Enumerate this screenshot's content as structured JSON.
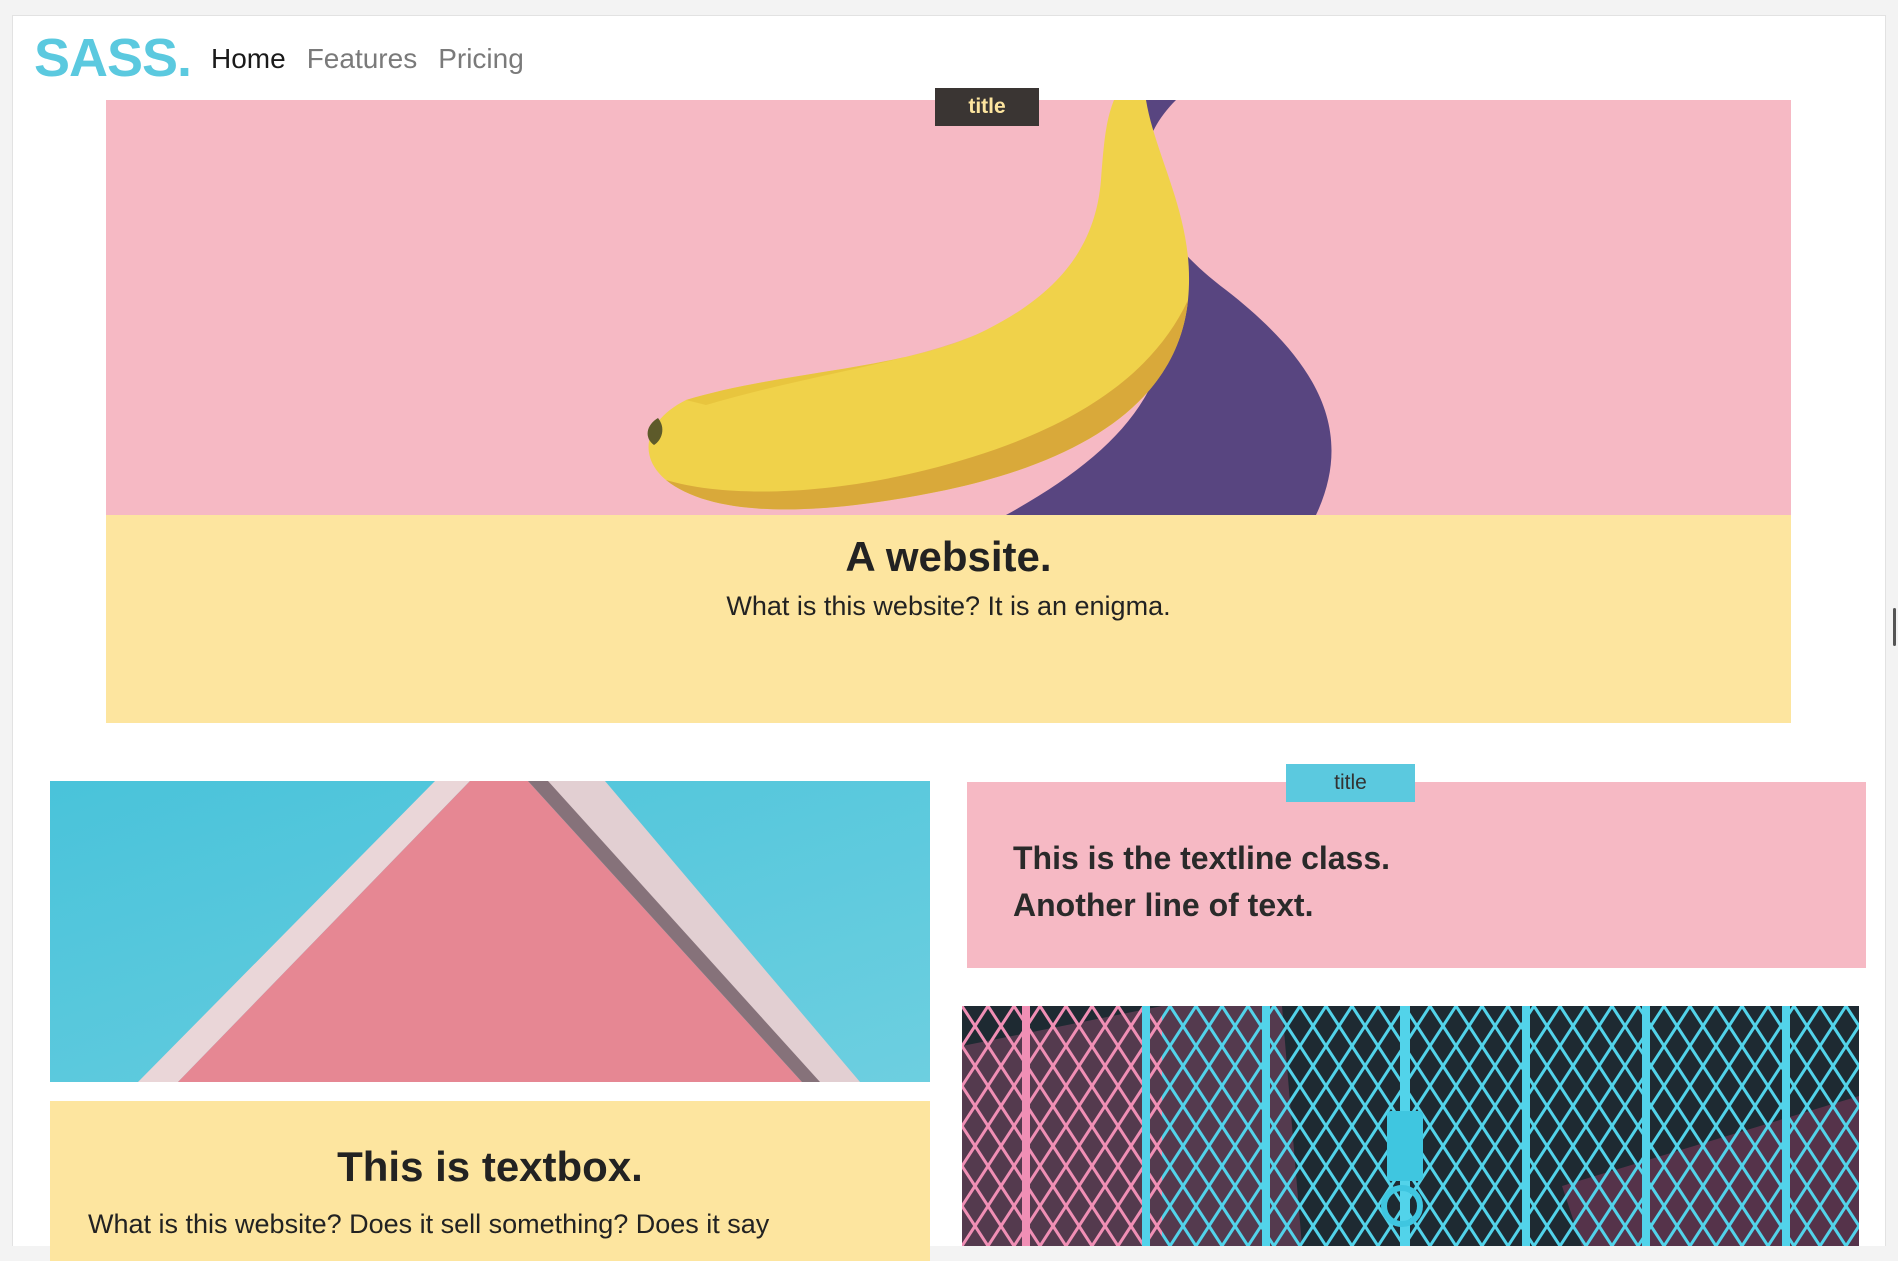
{
  "brand": {
    "logo": "SASS."
  },
  "nav": {
    "items": [
      {
        "label": "Home",
        "active": true
      },
      {
        "label": "Features",
        "active": false
      },
      {
        "label": "Pricing",
        "active": false
      }
    ]
  },
  "hero": {
    "tag": "title",
    "heading": "A website.",
    "subheading": "What is this website? It is an enigma."
  },
  "textbox": {
    "heading": "This is textbox.",
    "body": "What is this website? Does it sell something? Does it say"
  },
  "textline": {
    "tag": "title",
    "line1": "This is the textline class.",
    "line2": "Another line of text."
  },
  "colors": {
    "accent": "#5bc9df",
    "pink": "#f6b9c4",
    "yellow": "#fde59f",
    "dark": "#3a3533"
  },
  "icons": [
    "banana-photo",
    "roof-photo",
    "fence-photo"
  ]
}
